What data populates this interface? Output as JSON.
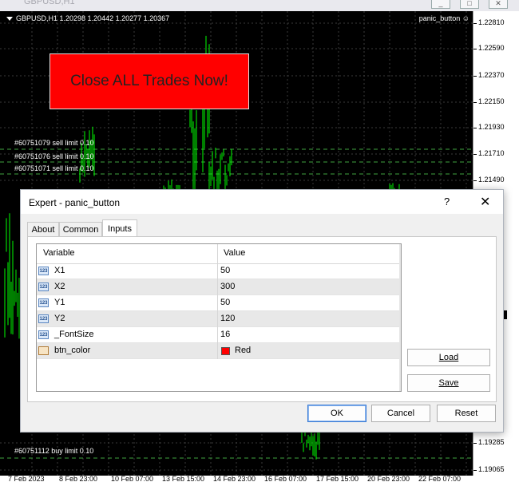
{
  "window": {
    "title": "GBPUSD,H1"
  },
  "chart": {
    "symbol_info": "GBPUSD,H1  1.20298 1.20442 1.20277 1.20367",
    "ea_name": "panic_button",
    "ea_icon": "smiley-icon",
    "panic_button_label": "Close ALL Trades Now!",
    "panic_button_color": "#ff0000",
    "candle_color": "#00ff00",
    "order_lines": [
      {
        "label": "#60751079 sell limit 0.10"
      },
      {
        "label": "#60751076 sell limit 0.10"
      },
      {
        "label": "#60751071 sell limit 0.10"
      },
      {
        "label": "#60751112 buy limit 0.10"
      }
    ],
    "price_labels": [
      "1.22810",
      "1.22590",
      "1.22370",
      "1.22150",
      "1.21930",
      "1.21710",
      "1.21490",
      "1.19285",
      "1.19065"
    ],
    "time_labels": [
      "7 Feb 2023",
      "8 Feb 23:00",
      "10 Feb 07:00",
      "13 Feb 15:00",
      "14 Feb 23:00",
      "16 Feb 07:00",
      "17 Feb 15:00",
      "20 Feb 23:00",
      "22 Feb 07:00"
    ]
  },
  "dialog": {
    "title": "Expert - panic_button",
    "help_label": "?",
    "close_label": "✕",
    "tabs": [
      {
        "label": "About",
        "active": false
      },
      {
        "label": "Common",
        "active": false
      },
      {
        "label": "Inputs",
        "active": true
      }
    ],
    "columns": {
      "variable": "Variable",
      "value": "Value"
    },
    "inputs": [
      {
        "icon": "int-icon",
        "icon_text": "123",
        "name": "X1",
        "value": "50"
      },
      {
        "icon": "int-icon",
        "icon_text": "123",
        "name": "X2",
        "value": "300"
      },
      {
        "icon": "int-icon",
        "icon_text": "123",
        "name": "Y1",
        "value": "50"
      },
      {
        "icon": "int-icon",
        "icon_text": "123",
        "name": "Y2",
        "value": "120"
      },
      {
        "icon": "int-icon",
        "icon_text": "123",
        "name": "_FontSize",
        "value": "16"
      },
      {
        "icon": "color-icon",
        "icon_text": "",
        "name": "btn_color",
        "value": "Red",
        "swatch": "#ff0000"
      }
    ],
    "buttons": {
      "load": "Load",
      "save": "Save",
      "ok": "OK",
      "cancel": "Cancel",
      "reset": "Reset"
    }
  }
}
